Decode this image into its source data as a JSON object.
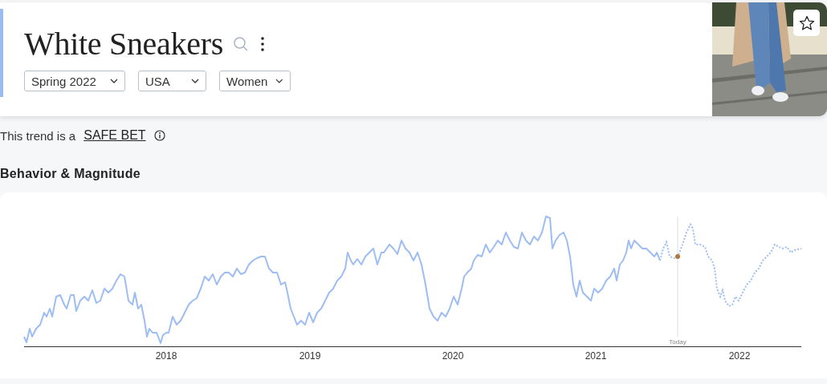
{
  "header": {
    "title": "White Sneakers",
    "filters": [
      {
        "value": "Spring 2022"
      },
      {
        "value": "USA"
      },
      {
        "value": "Women"
      }
    ],
    "photo": {
      "favorite": false
    }
  },
  "verdict": {
    "prefix": "This trend is a",
    "label": "SAFE BET"
  },
  "section_title": "Behavior & Magnitude",
  "chart": {
    "x_labels": [
      "2018",
      "2019",
      "2020",
      "2021",
      "2022"
    ],
    "today_label": "Today"
  }
}
